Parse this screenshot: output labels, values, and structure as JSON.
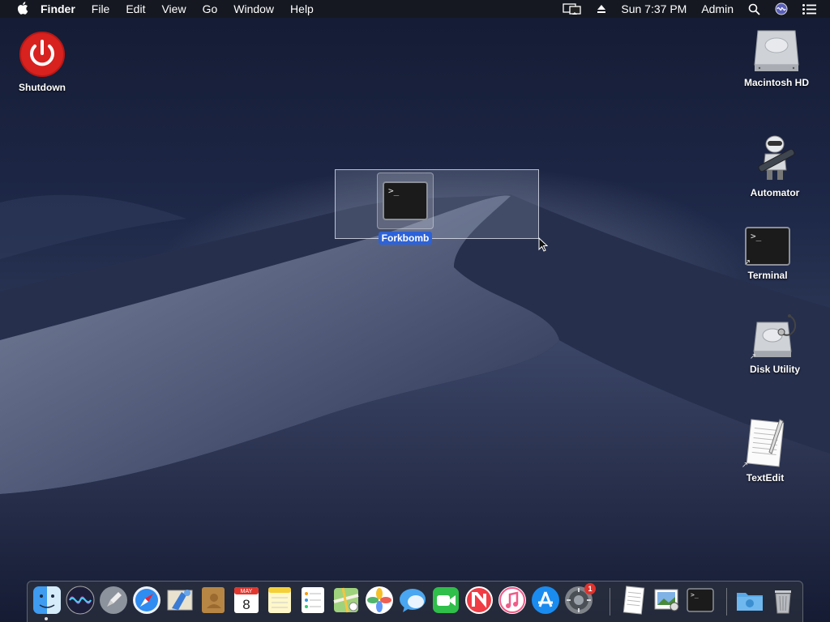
{
  "menubar": {
    "app_name": "Finder",
    "menus": [
      "File",
      "Edit",
      "View",
      "Go",
      "Window",
      "Help"
    ],
    "clock": "Sun 7:37 PM",
    "user": "Admin"
  },
  "desktop": {
    "icons": [
      {
        "label": "Shutdown",
        "icon": "power-icon",
        "color": "#d8221f"
      },
      {
        "label": "Macintosh HD",
        "icon": "hard-drive-icon"
      },
      {
        "label": "Automator",
        "icon": "automator-robot-icon"
      },
      {
        "label": "Terminal",
        "icon": "terminal-icon"
      },
      {
        "label": "Disk Utility",
        "icon": "disk-utility-icon"
      },
      {
        "label": "TextEdit",
        "icon": "textedit-icon"
      }
    ],
    "selected_icon": {
      "label": "Forkbomb",
      "icon": "terminal-script-icon",
      "prompt": ">_"
    },
    "terminal_prompt": ">_",
    "selection_color": "#2d62d8"
  },
  "dock": {
    "apps": [
      "finder-icon",
      "siri-icon",
      "launchpad-icon",
      "safari-icon",
      "mail-icon",
      "contacts-icon",
      "calendar-icon",
      "notes-icon",
      "reminders-icon",
      "maps-icon",
      "photos-icon",
      "messages-icon",
      "facetime-icon",
      "news-icon",
      "itunes-icon",
      "app-store-icon",
      "system-preferences-icon"
    ],
    "calendar_month": "MAY",
    "calendar_day": "8",
    "system_preferences_badge": "1",
    "recent_apps": [
      "textedit-icon",
      "preview-icon",
      "terminal-icon"
    ],
    "folders": [
      "downloads-folder-icon",
      "trash-icon"
    ]
  }
}
